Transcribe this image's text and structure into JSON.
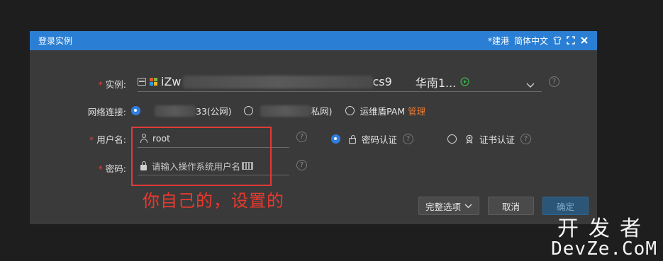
{
  "dialog": {
    "title": "登录实例",
    "region_badge": "*建港",
    "language": "简体中文",
    "icons": [
      "shirt-icon",
      "expand-icon",
      "close-icon"
    ]
  },
  "instance": {
    "label": "实例:",
    "name_prefix": "iZw",
    "name_suffix": "cs9",
    "region": "华南1...",
    "status": "running"
  },
  "network": {
    "label": "网络连接:",
    "options": [
      {
        "visible_text": "33(公网)",
        "selected": true
      },
      {
        "visible_text": "私网)",
        "selected": false
      },
      {
        "text": "运维盾PAM",
        "selected": false
      }
    ],
    "manage_link": "管理"
  },
  "username": {
    "label": "用户名:",
    "value": "root"
  },
  "auth": {
    "options": [
      {
        "label": "密码认证",
        "selected": true
      },
      {
        "label": "证书认证",
        "selected": false
      }
    ]
  },
  "password": {
    "label": "密码:",
    "placeholder": "请输入操作系统用户名"
  },
  "buttons": {
    "advanced": "完整选项",
    "cancel": "取消",
    "confirm": "确定"
  },
  "annotation": "你自己的，设置的",
  "watermark": {
    "cn": "开发者",
    "en": "DevZe.CoM"
  },
  "colors": {
    "titlebar": "#2a7fd4",
    "accent": "#2f7fe0",
    "link": "#e8792f",
    "status_green": "#3cb04a",
    "annotation_red": "#e03a3a"
  }
}
